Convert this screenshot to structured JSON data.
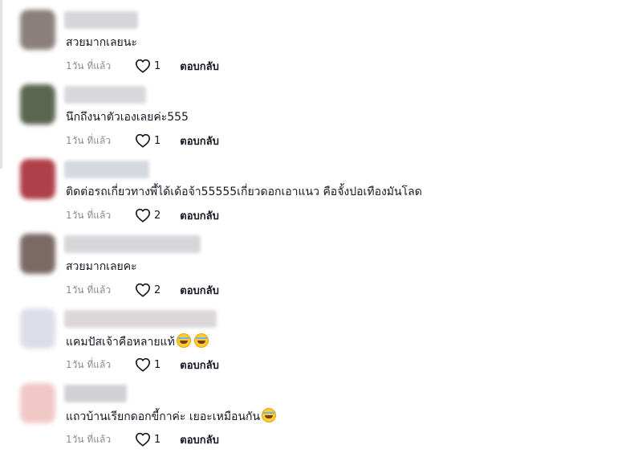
{
  "comments": [
    {
      "text": "สวยมากเลยนะ",
      "time": "1วัน ที่แล้ว",
      "likes": "1",
      "reply_label": "ตอบกลับ",
      "avatar_color": "#8a7f7b",
      "username_color": "#cfcfd4",
      "emoji_count": 0
    },
    {
      "text": "นึกถึงนาตัวเองเลยค่ะ555",
      "time": "1วัน ที่แล้ว",
      "likes": "1",
      "reply_label": "ตอบกลับ",
      "avatar_color": "#5b6650",
      "username_color": "#d2d2d6",
      "emoji_count": 0
    },
    {
      "text": "ติดต่อรถเกี่ยวทางพี้ได้เด้อจ้า55555เกี่ยวดอกเอาแนว คือจั้งปอเทืองมันโลด",
      "time": "1วัน ที่แล้ว",
      "likes": "2",
      "reply_label": "ตอบกลับ",
      "avatar_color": "#b0404a",
      "username_color": "#cdd2da",
      "emoji_count": 0
    },
    {
      "text": "สวยมากเลยคะ",
      "time": "1วัน ที่แล้ว",
      "likes": "2",
      "reply_label": "ตอบกลับ",
      "avatar_color": "#7c6a66",
      "username_color": "#d0d0d4",
      "emoji_count": 0
    },
    {
      "text": "แคมปัสเจ้าคือหลายแท้",
      "time": "1วัน ที่แล้ว",
      "likes": "1",
      "reply_label": "ตอบกลับ",
      "avatar_color": "#dcdde8",
      "username_color": "#d6d0d2",
      "emoji_count": 2
    },
    {
      "text": "แถวบ้านเรียกดอกขี้กาค่ะ เยอะเหมือนกัน",
      "time": "1วัน ที่แล้ว",
      "likes": "1",
      "reply_label": "ตอบกลับ",
      "avatar_color": "#f0c9c6",
      "username_color": "#c9c9ce",
      "emoji_count": 1
    }
  ]
}
